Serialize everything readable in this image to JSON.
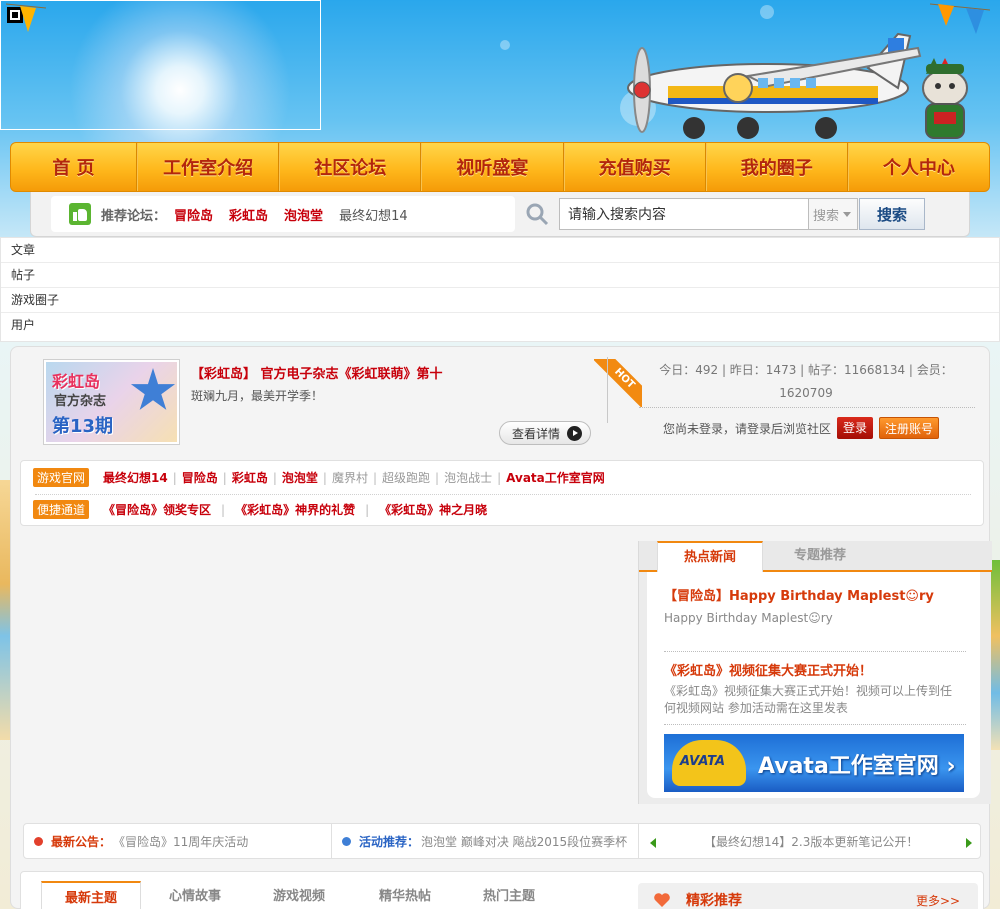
{
  "nav": {
    "items": [
      "首 页",
      "工作室介绍",
      "社区论坛",
      "视听盛宴",
      "充值购买",
      "我的圈子",
      "个人中心"
    ]
  },
  "recommend": {
    "label": "推荐论坛：",
    "links": [
      "冒险岛",
      "彩虹岛",
      "泡泡堂",
      "最终幻想14"
    ]
  },
  "search": {
    "input_value": "请输入搜索内容",
    "select_value": "搜索",
    "button_label": "搜索"
  },
  "dropdown": {
    "items": [
      "文章",
      "帖子",
      "游戏圈子",
      "用户"
    ]
  },
  "feature": {
    "image_text": [
      "彩虹岛",
      "官方杂志",
      "第13期"
    ],
    "title": "【彩虹岛】 官方电子杂志《彩虹联萌》第十",
    "desc": "斑斓九月，最美开学季！",
    "button_label": "查看详情",
    "hot_label": "HOT"
  },
  "stats": {
    "line": "今日：492 | 昨日：1473 | 帖子：11668134 | 会员：1620709",
    "login_text": "您尚未登录，请登录后浏览社区",
    "login_label": "登录",
    "register_label": "注册账号"
  },
  "quick_links": {
    "row1_tag": "游戏官网",
    "row1_links": [
      "最终幻想14",
      "冒险岛",
      "彩虹岛",
      "泡泡堂",
      "魔界村",
      "超级跑跑",
      "泡泡战士",
      "Avata工作室官网"
    ],
    "row2_tag": "便捷通道",
    "row2_links": [
      "《冒险岛》领奖专区",
      "《彩虹岛》神界的礼赞",
      "《彩虹岛》神之月晓"
    ]
  },
  "news": {
    "tabs": [
      "热点新闻",
      "专题推荐"
    ],
    "items": [
      {
        "title": "【冒险岛】Happy Birthday Maplest☺ry",
        "desc": "Happy Birthday Maplest☺ry"
      },
      {
        "title": "《彩虹岛》视频征集大赛正式开始！",
        "desc": "《彩虹岛》视频征集大赛正式开始！视频可以上传到任何视频网站 参加活动需在这里发表"
      }
    ],
    "banner_logo": "AVATA",
    "banner_text": "Avata工作室官网 ›"
  },
  "ticker": {
    "announce_label": "最新公告：",
    "announce_text": "《冒险岛》11周年庆活动",
    "activity_label": "活动推荐：",
    "activity_text": "泡泡堂 巅峰对决 飚战2015段位赛季杯",
    "scroll_text": "【最终幻想14】2.3版本更新笔记公开！"
  },
  "bottom_tabs": {
    "tabs": [
      "最新主题",
      "心情故事",
      "游戏视频",
      "精华热帖",
      "热门主题"
    ],
    "highlight_title": "精彩推荐",
    "more_label": "更多>>"
  },
  "colors": {
    "nav_text": "#b3260d",
    "accent_red": "#c7000b",
    "accent_orange": "#f18810"
  }
}
